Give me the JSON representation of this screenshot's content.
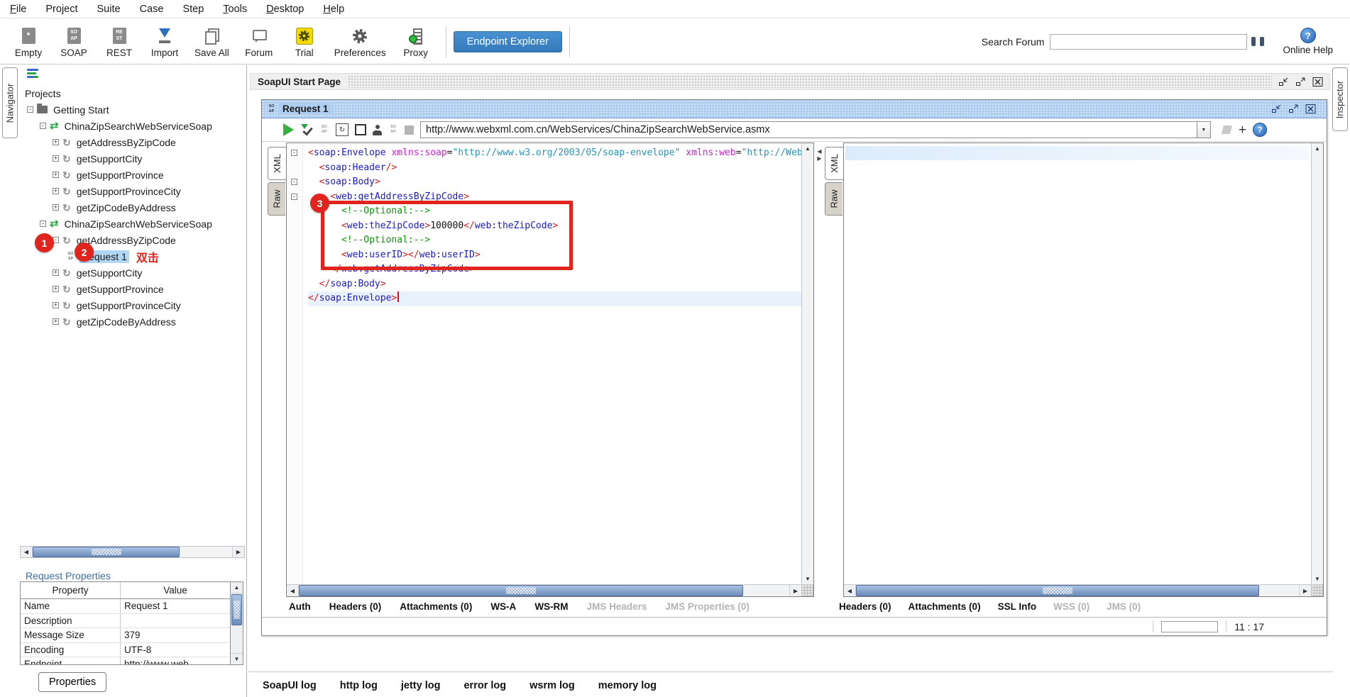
{
  "menu": {
    "items": [
      {
        "label": "File",
        "u": true
      },
      {
        "label": "Project",
        "u": false
      },
      {
        "label": "Suite",
        "u": false
      },
      {
        "label": "Case",
        "u": false
      },
      {
        "label": "Step",
        "u": false
      },
      {
        "label": "Tools",
        "u": true
      },
      {
        "label": "Desktop",
        "u": true
      },
      {
        "label": "Help",
        "u": true
      }
    ]
  },
  "toolbar": {
    "buttons": [
      {
        "label": "Empty",
        "icon": "empty-project-icon"
      },
      {
        "label": "SOAP",
        "icon": "soap-project-icon"
      },
      {
        "label": "REST",
        "icon": "rest-project-icon"
      },
      {
        "label": "Import",
        "icon": "import-icon"
      },
      {
        "label": "Save All",
        "icon": "save-all-icon"
      },
      {
        "label": "Forum",
        "icon": "forum-icon"
      },
      {
        "label": "Trial",
        "icon": "trial-icon"
      },
      {
        "label": "Preferences",
        "icon": "preferences-gear-icon"
      },
      {
        "label": "Proxy",
        "icon": "proxy-icon"
      }
    ],
    "endpoint_explorer_label": "Endpoint Explorer",
    "search_forum_label": "Search Forum",
    "search_value": "",
    "online_help_label": "Online Help"
  },
  "side_tabs": {
    "left": "Navigator",
    "right": "Inspector"
  },
  "navigator": {
    "root_label": "Projects",
    "tree": [
      {
        "label": "Getting Start",
        "icon": "folder",
        "depth": 1,
        "exp": "minus"
      },
      {
        "label": "ChinaZipSearchWebServiceSoap",
        "icon": "interface",
        "depth": 2,
        "exp": "minus"
      },
      {
        "label": "getAddressByZipCode",
        "icon": "operation",
        "depth": 3,
        "exp": "plus"
      },
      {
        "label": "getSupportCity",
        "icon": "operation",
        "depth": 3,
        "exp": "plus"
      },
      {
        "label": "getSupportProvince",
        "icon": "operation",
        "depth": 3,
        "exp": "plus"
      },
      {
        "label": "getSupportProvinceCity",
        "icon": "operation",
        "depth": 3,
        "exp": "plus"
      },
      {
        "label": "getZipCodeByAddress",
        "icon": "operation",
        "depth": 3,
        "exp": "plus"
      },
      {
        "label": "ChinaZipSearchWebServiceSoap",
        "icon": "interface",
        "depth": 2,
        "exp": "minus"
      },
      {
        "label": "getAddressByZipCode",
        "icon": "operation",
        "depth": 3,
        "exp": "minus"
      },
      {
        "label": "Request 1",
        "icon": "request",
        "depth": 4,
        "exp": "none",
        "selected": true,
        "annotation": "双击"
      },
      {
        "label": "getSupportCity",
        "icon": "operation",
        "depth": 3,
        "exp": "plus"
      },
      {
        "label": "getSupportProvince",
        "icon": "operation",
        "depth": 3,
        "exp": "plus"
      },
      {
        "label": "getSupportProvinceCity",
        "icon": "operation",
        "depth": 3,
        "exp": "plus"
      },
      {
        "label": "getZipCodeByAddress",
        "icon": "operation",
        "depth": 3,
        "exp": "plus"
      }
    ]
  },
  "properties_panel": {
    "title": "Request Properties",
    "columns": [
      "Property",
      "Value"
    ],
    "rows": [
      [
        "Name",
        "Request 1"
      ],
      [
        "Description",
        ""
      ],
      [
        "Message Size",
        "379"
      ],
      [
        "Encoding",
        "UTF-8"
      ],
      [
        "Endpoint",
        "http://www.web..."
      ]
    ],
    "button_label": "Properties"
  },
  "desktop": {
    "start_page_tab": "SoapUI Start Page"
  },
  "request_window": {
    "title": "Request 1",
    "url": "http://www.webxml.com.cn/WebServices/ChinaZipSearchWebService.asmx",
    "editor_tabs": [
      "XML",
      "Raw"
    ],
    "request_tabs": [
      {
        "label": "Auth",
        "enabled": true
      },
      {
        "label": "Headers (0)",
        "enabled": true
      },
      {
        "label": "Attachments (0)",
        "enabled": true
      },
      {
        "label": "WS-A",
        "enabled": true
      },
      {
        "label": "WS-RM",
        "enabled": true
      },
      {
        "label": "JMS Headers",
        "enabled": false
      },
      {
        "label": "JMS Properties (0)",
        "enabled": false
      }
    ],
    "response_tabs": [
      {
        "label": "Headers (0)",
        "enabled": true
      },
      {
        "label": "Attachments (0)",
        "enabled": true
      },
      {
        "label": "SSL Info",
        "enabled": true
      },
      {
        "label": "WSS (0)",
        "enabled": false
      },
      {
        "label": "JMS (0)",
        "enabled": false
      }
    ],
    "status_position": "11 : 17",
    "xml_lines": [
      {
        "fold": "m",
        "seg": [
          [
            "<",
            "b"
          ],
          [
            "soap:Envelope",
            "t"
          ],
          [
            " ",
            "p"
          ],
          [
            "xmlns:soap",
            "a"
          ],
          [
            "=",
            "p"
          ],
          [
            "\"http://www.w3.org/2003/05/soap-envelope\"",
            "v"
          ],
          [
            " ",
            "p"
          ],
          [
            "xmlns:web",
            "a"
          ],
          [
            "=",
            "p"
          ],
          [
            "\"http://WebXml.com.cn/",
            "v"
          ]
        ]
      },
      {
        "fold": "",
        "seg": [
          [
            "  ",
            "p"
          ],
          [
            "<",
            "b"
          ],
          [
            "soap:Header",
            "t"
          ],
          [
            "/>",
            "b"
          ]
        ]
      },
      {
        "fold": "m",
        "seg": [
          [
            "  ",
            "p"
          ],
          [
            "<",
            "b"
          ],
          [
            "soap:Body",
            "t"
          ],
          [
            ">",
            "b"
          ]
        ]
      },
      {
        "fold": "m",
        "seg": [
          [
            "    ",
            "p"
          ],
          [
            "<",
            "b"
          ],
          [
            "web:getAddressByZipCode",
            "t"
          ],
          [
            ">",
            "b"
          ]
        ]
      },
      {
        "fold": "",
        "seg": [
          [
            "      ",
            "p"
          ],
          [
            "<!--Optional:-->",
            "c"
          ]
        ]
      },
      {
        "fold": "",
        "seg": [
          [
            "      ",
            "p"
          ],
          [
            "<",
            "b"
          ],
          [
            "web:theZipCode",
            "t"
          ],
          [
            ">",
            "b"
          ],
          [
            "100000",
            "p"
          ],
          [
            "</",
            "b"
          ],
          [
            "web:theZipCode",
            "t"
          ],
          [
            ">",
            "b"
          ]
        ]
      },
      {
        "fold": "",
        "seg": [
          [
            "      ",
            "p"
          ],
          [
            "<!--Optional:-->",
            "c"
          ]
        ]
      },
      {
        "fold": "",
        "seg": [
          [
            "      ",
            "p"
          ],
          [
            "<",
            "b"
          ],
          [
            "web:userID",
            "t"
          ],
          [
            ">",
            "b"
          ],
          [
            "</",
            "b"
          ],
          [
            "web:userID",
            "t"
          ],
          [
            ">",
            "b"
          ]
        ]
      },
      {
        "fold": "",
        "seg": [
          [
            "    ",
            "p"
          ],
          [
            "</",
            "b"
          ],
          [
            "web:getAddressByZipCode",
            "t"
          ],
          [
            ">",
            "b"
          ]
        ]
      },
      {
        "fold": "",
        "seg": [
          [
            "  ",
            "p"
          ],
          [
            "</",
            "b"
          ],
          [
            "soap:Body",
            "t"
          ],
          [
            ">",
            "b"
          ]
        ]
      },
      {
        "fold": "",
        "cur": true,
        "caret": true,
        "seg": [
          [
            "</",
            "b"
          ],
          [
            "soap:Envelope",
            "t"
          ],
          [
            ">",
            "b"
          ]
        ]
      }
    ]
  },
  "annotations": {
    "step1": "1",
    "step2": "2",
    "step3": "3",
    "double_click_label": "双击"
  },
  "log_tabs": [
    "SoapUI log",
    "http log",
    "jetty log",
    "error log",
    "wsrm log",
    "memory log"
  ],
  "colors": {
    "annotation_red": "#e0251f",
    "selection_blue": "#b2d6f5",
    "titlebar_blue": "#aecdf0",
    "endpoint_button_blue": "#3579b8",
    "syntax_bracket": "#d21d1d",
    "syntax_tag": "#1a1acc",
    "syntax_attr": "#cc22cc",
    "syntax_value": "#2a93b8",
    "syntax_comment": "#0a9a0a"
  }
}
